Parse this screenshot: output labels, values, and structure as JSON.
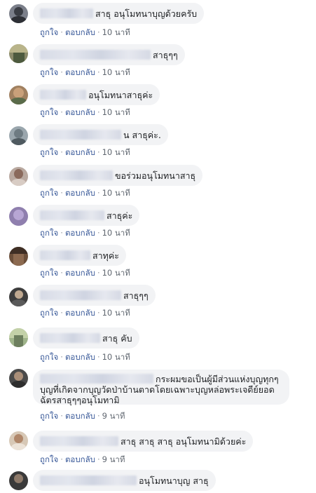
{
  "comments": [
    {
      "text": "สาธุ อนุโมทนาบุญด้วยครับ",
      "like": "ถูกใจ",
      "reply": "ตอบกลับ",
      "time": "10 นาที"
    },
    {
      "text": "สาธุๆๆ",
      "like": "ถูกใจ",
      "reply": "ตอบกลับ",
      "time": "10 นาที"
    },
    {
      "text": "อนุโมทนาสาธุค่ะ",
      "like": "ถูกใจ",
      "reply": "ตอบกลับ",
      "time": "10 นาที"
    },
    {
      "text": "น สาธุค่ะ.",
      "like": "ถูกใจ",
      "reply": "ตอบกลับ",
      "time": "10 นาที"
    },
    {
      "text": "ขอร่วมอนุโมทนาสาธุ",
      "like": "ถูกใจ",
      "reply": "ตอบกลับ",
      "time": "10 นาที"
    },
    {
      "text": "สาธุค่ะ",
      "like": "ถูกใจ",
      "reply": "ตอบกลับ",
      "time": "10 นาที"
    },
    {
      "text": "สาทุค่ะ",
      "like": "ถูกใจ",
      "reply": "ตอบกลับ",
      "time": "10 นาที"
    },
    {
      "text": "สาธุๆๆ",
      "like": "ถูกใจ",
      "reply": "ตอบกลับ",
      "time": "10 นาที"
    },
    {
      "text": "สาธุ คับ",
      "like": "ถูกใจ",
      "reply": "ตอบกลับ",
      "time": "10 นาที"
    },
    {
      "text_line1": "กระผมขอเป็นผู้มีส่วนแห่งบุญทุกๆ",
      "text_line2": "บุญที่เกิดจากบุญวัดป่าบ้านตาดโดยเฉพาะบุญหล่อพระเจดีย์ยอด",
      "text_line3": "ฉัตรสาธุๆๆอนุโมทามิ",
      "like": "ถูกใจ",
      "reply": "ตอบกลับ",
      "time": "9 นาที"
    },
    {
      "text": "สาธุ สาธุ สาธุ อนุโมทนามิด้วยค่ะ",
      "like": "ถูกใจ",
      "reply": "ตอบกลับ",
      "time": "9 นาที"
    },
    {
      "text": "อนุโมทนาบุญ สาธุ"
    }
  ],
  "colors": {
    "bubble": "#f2f3f5",
    "link": "#385898",
    "meta": "#606770"
  }
}
